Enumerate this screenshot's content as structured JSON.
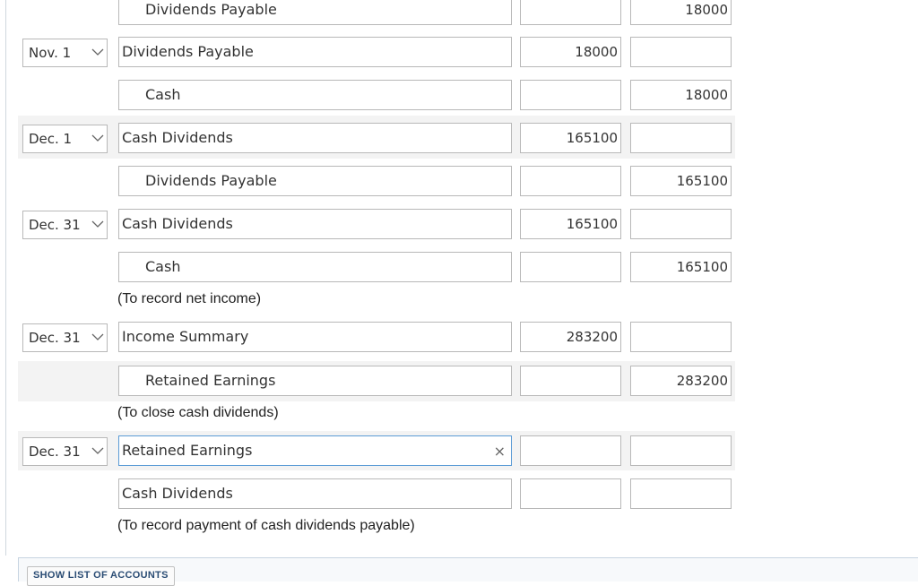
{
  "entries": [
    {
      "date": "",
      "account": "Dividends Payable",
      "debit": "",
      "credit": "18000",
      "indent": true
    },
    {
      "date": "Nov. 1",
      "account": "Dividends Payable",
      "debit": "18000",
      "credit": "",
      "indent": false
    },
    {
      "date": "",
      "account": "Cash",
      "debit": "",
      "credit": "18000",
      "indent": true
    },
    {
      "date": "Dec. 1",
      "account": "Cash Dividends",
      "debit": "165100",
      "credit": "",
      "indent": false
    },
    {
      "date": "",
      "account": "Dividends Payable",
      "debit": "",
      "credit": "165100",
      "indent": true
    },
    {
      "date": "Dec. 31",
      "account": "Cash Dividends",
      "debit": "165100",
      "credit": "",
      "indent": false
    },
    {
      "date": "",
      "account": "Cash",
      "debit": "",
      "credit": "165100",
      "indent": true
    },
    {
      "date": "Dec. 31",
      "account": "Income Summary",
      "debit": "283200",
      "credit": "",
      "indent": false
    },
    {
      "date": "",
      "account": "Retained Earnings",
      "debit": "",
      "credit": "283200",
      "indent": true
    },
    {
      "date": "Dec. 31",
      "account": "Retained Earnings",
      "debit": "",
      "credit": "",
      "indent": false
    },
    {
      "date": "",
      "account": "Cash Dividends",
      "debit": "",
      "credit": "",
      "indent": false
    }
  ],
  "notes": [
    "(To record net income)",
    "(To close cash dividends)",
    "(To record payment of cash dividends payable)"
  ],
  "clear_icon": "×",
  "chevron_icon": "chevron-down-icon",
  "show_accounts_label": "SHOW LIST OF ACCOUNTS"
}
